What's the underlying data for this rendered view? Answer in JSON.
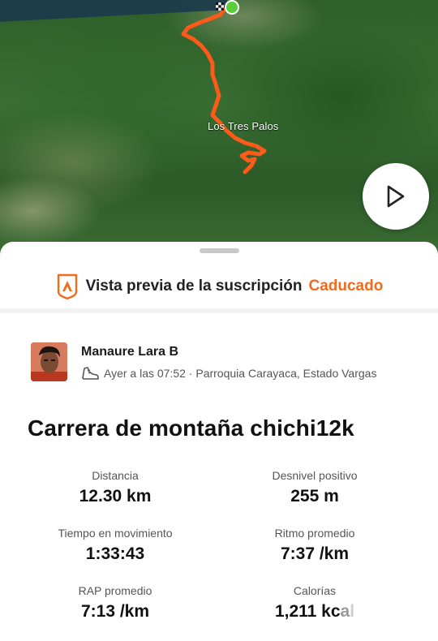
{
  "map": {
    "place_label": "Los Tres Palos"
  },
  "subscription": {
    "text": "Vista previa de la suscripción",
    "status": "Caducado",
    "status_color": "#f26b1d"
  },
  "athlete": {
    "name": "Manaure Lara B",
    "activity_icon": "run-shoe-icon",
    "meta": "Ayer a las 07:52 · Parroquia Carayaca, Estado Vargas"
  },
  "activity": {
    "title": "Carrera de montaña chichi12k"
  },
  "stats": [
    {
      "label": "Distancia",
      "value": "12.30 km"
    },
    {
      "label": "Desnivel positivo",
      "value": "255 m"
    },
    {
      "label": "Tiempo en movimiento",
      "value": "1:33:43"
    },
    {
      "label": "Ritmo promedio",
      "value": "7:37 /km"
    },
    {
      "label": "RAP promedio",
      "value": "7:13 /km"
    },
    {
      "label": "Calorías",
      "value_main": "1,211 kc",
      "value_fade1": "a",
      "value_fade2": "l"
    }
  ],
  "colors": {
    "route": "#ff5a1a",
    "brand": "#f26b1d"
  }
}
